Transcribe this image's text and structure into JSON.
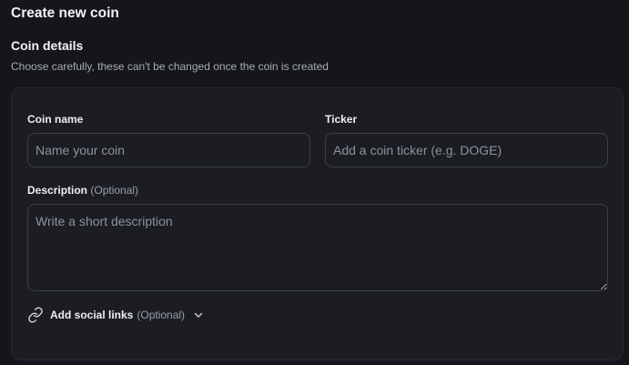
{
  "header": {
    "title": "Create new coin"
  },
  "section": {
    "title": "Coin details",
    "subtitle": "Choose carefully, these can't be changed once the coin is created"
  },
  "form": {
    "coin_name": {
      "label": "Coin name",
      "placeholder": "Name your coin",
      "value": ""
    },
    "ticker": {
      "label": "Ticker",
      "placeholder": "Add a coin ticker (e.g. DOGE)",
      "value": ""
    },
    "description": {
      "label": "Description",
      "optional": "(Optional)",
      "placeholder": "Write a short description",
      "value": ""
    },
    "social_links": {
      "label": "Add social links",
      "optional": "(Optional)",
      "icon": "link-icon",
      "toggle_icon": "chevron-down-icon"
    }
  },
  "colors": {
    "background": "#15161b",
    "card": "#1b1d23",
    "border": "#3c3f49",
    "text": "#e7e8ec",
    "muted": "#9a9ea9"
  }
}
